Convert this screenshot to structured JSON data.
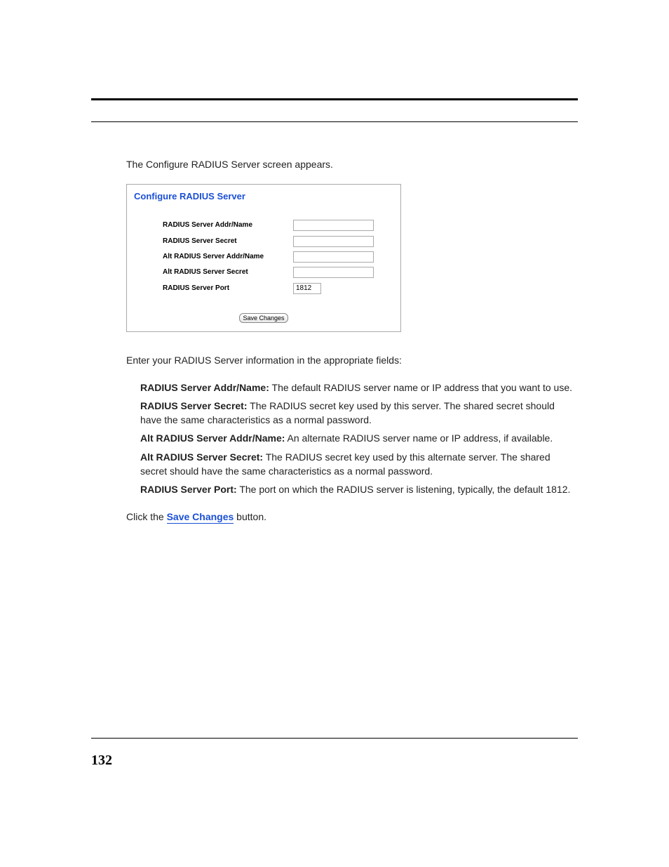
{
  "intro": "The Configure RADIUS Server screen appears.",
  "panel": {
    "title": "Configure RADIUS Server",
    "fields": {
      "addr_label": "RADIUS Server Addr/Name",
      "addr_value": "",
      "secret_label": "RADIUS Server Secret",
      "secret_value": "",
      "alt_addr_label": "Alt RADIUS Server Addr/Name",
      "alt_addr_value": "",
      "alt_secret_label": "Alt RADIUS Server Secret",
      "alt_secret_value": "",
      "port_label": "RADIUS Server Port",
      "port_value": "1812"
    },
    "save_button": "Save Changes"
  },
  "enter_info": "Enter your RADIUS Server information in the appropriate fields:",
  "defs": {
    "addr_term": "RADIUS Server Addr/Name:",
    "addr_text": " The default RADIUS server name or IP address that you want to use.",
    "secret_term": "RADIUS Server Secret:",
    "secret_text": " The RADIUS secret key used by this server. The shared secret should have the same characteristics as a normal password.",
    "alt_addr_term": "Alt RADIUS Server Addr/Name:",
    "alt_addr_text": " An alternate RADIUS server name or IP address, if available.",
    "alt_secret_term": "Alt RADIUS Server Secret:",
    "alt_secret_text": " The RADIUS secret key used by this alternate server. The shared secret should have the same characteristics as a normal password.",
    "port_term": "RADIUS Server Port:",
    "port_text": " The port on which the RADIUS server is listening, typically, the default 1812."
  },
  "closing": {
    "prefix": "Click the ",
    "link": "Save Changes",
    "suffix": " button."
  },
  "page_number": "132"
}
